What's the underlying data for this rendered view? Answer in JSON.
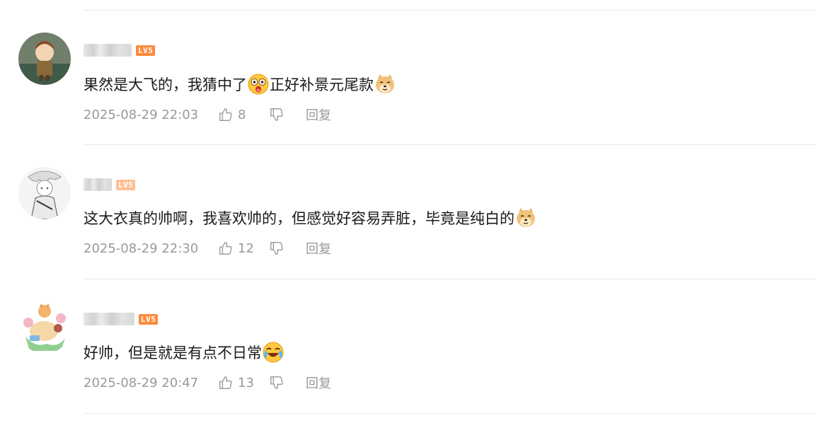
{
  "comments": [
    {
      "username_visible": "",
      "level": "LV5",
      "text_before": "果然是大飞的，我猜中了",
      "emoji_mid": "shocked-face-emoji",
      "text_after": "正好补景元尾款",
      "emoji_end": "doge-emoji",
      "time": "2025-08-29 22:03",
      "likes": "8",
      "reply_label": "回复"
    },
    {
      "username_visible": "",
      "level": "LV5",
      "text_before": "这大衣真的帅啊，我喜欢帅的，但感觉好容易弄脏，毕竟是纯白的",
      "emoji_end": "doge-emoji",
      "time": "2025-08-29 22:30",
      "likes": "12",
      "reply_label": "回复"
    },
    {
      "username_visible": "",
      "level": "LV5",
      "text_before": "好帅，但是就是有点不日常",
      "emoji_end": "crying-laugh-emoji",
      "time": "2025-08-29 20:47",
      "likes": "13",
      "reply_label": "回复"
    }
  ],
  "colors": {
    "level_badge": "#ff8a3c",
    "meta_text": "#999999",
    "divider": "#e9e9e9",
    "body_text": "#1a1a1a"
  }
}
